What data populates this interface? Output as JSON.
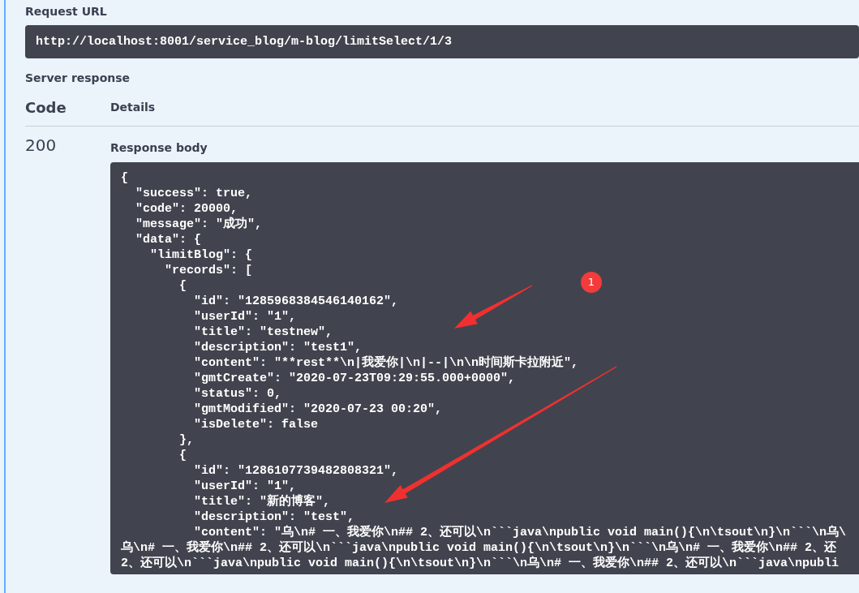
{
  "request_url": {
    "label": "Request URL",
    "url": "http://localhost:8001/service_blog/m-blog/limitSelect/1/3"
  },
  "server_response": {
    "label": "Server response",
    "columns": [
      "Code",
      "Details"
    ],
    "code": "200",
    "body_label": "Response body",
    "body_lines": [
      "{",
      "  \"success\": true,",
      "  \"code\": 20000,",
      "  \"message\": \"成功\",",
      "  \"data\": {",
      "    \"limitBlog\": {",
      "      \"records\": [",
      "        {",
      "          \"id\": \"1285968384546140162\",",
      "          \"userId\": \"1\",",
      "          \"title\": \"testnew\",",
      "          \"description\": \"test1\",",
      "          \"content\": \"**rest**\\n|我爱你|\\n|--|\\n\\n时间斯卡拉附近\",",
      "          \"gmtCreate\": \"2020-07-23T09:29:55.000+0000\",",
      "          \"status\": 0,",
      "          \"gmtModified\": \"2020-07-23 00:20\",",
      "          \"isDelete\": false",
      "        },",
      "        {",
      "          \"id\": \"1286107739482808321\",",
      "          \"userId\": \"1\",",
      "          \"title\": \"新的博客\",",
      "          \"description\": \"test\",",
      "          \"content\": \"乌\\n# 一、我爱你\\n## 2、还可以\\n```java\\npublic void main(){\\n\\tsout\\n}\\n```\\n乌\\",
      "乌\\n# 一、我爱你\\n## 2、还可以\\n```java\\npublic void main(){\\n\\tsout\\n}\\n```\\n乌\\n# 一、我爱你\\n## 2、还",
      "2、还可以\\n```java\\npublic void main(){\\n\\tsout\\n}\\n```\\n乌\\n# 一、我爱你\\n## 2、还可以\\n```java\\npubli"
    ]
  },
  "annotation": {
    "badge": "1"
  }
}
